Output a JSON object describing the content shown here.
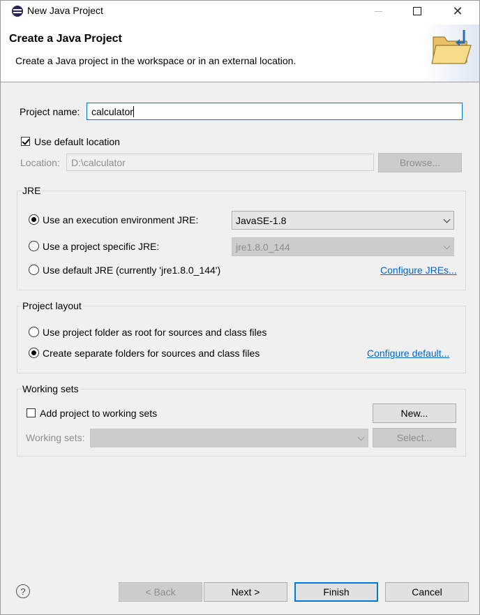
{
  "window": {
    "title": "New Java Project",
    "close_glyph": "✕"
  },
  "banner": {
    "title": "Create a Java Project",
    "description": "Create a Java project in the workspace or in an external location.",
    "icon": "folder-wizard-icon"
  },
  "project": {
    "name_label": "Project name:",
    "name_value": "calculator",
    "use_default_label": "Use default location",
    "use_default_checked": true,
    "location_label": "Location:",
    "location_value": "D:\\calculator",
    "browse_label": "Browse..."
  },
  "jre": {
    "group_label": "JRE",
    "exec_env_label": "Use an execution environment JRE:",
    "exec_env_value": "JavaSE-1.8",
    "project_specific_label": "Use a project specific JRE:",
    "project_specific_value": "jre1.8.0_144",
    "default_label": "Use default JRE (currently 'jre1.8.0_144')",
    "configure_link": "Configure JREs...",
    "selected": "exec_env"
  },
  "layout": {
    "group_label": "Project layout",
    "root_label": "Use project folder as root for sources and class files",
    "separate_label": "Create separate folders for sources and class files",
    "configure_link": "Configure default...",
    "selected": "separate"
  },
  "working_sets": {
    "group_label": "Working sets",
    "add_label": "Add project to working sets",
    "add_checked": false,
    "new_label": "New...",
    "sets_label": "Working sets:",
    "select_label": "Select..."
  },
  "footer": {
    "help_glyph": "?",
    "back_label": "< Back",
    "next_label": "Next >",
    "finish_label": "Finish",
    "cancel_label": "Cancel"
  },
  "colors": {
    "accent": "#0078d7",
    "link": "#0066cc",
    "dialog_bg": "#f0f0f0"
  }
}
